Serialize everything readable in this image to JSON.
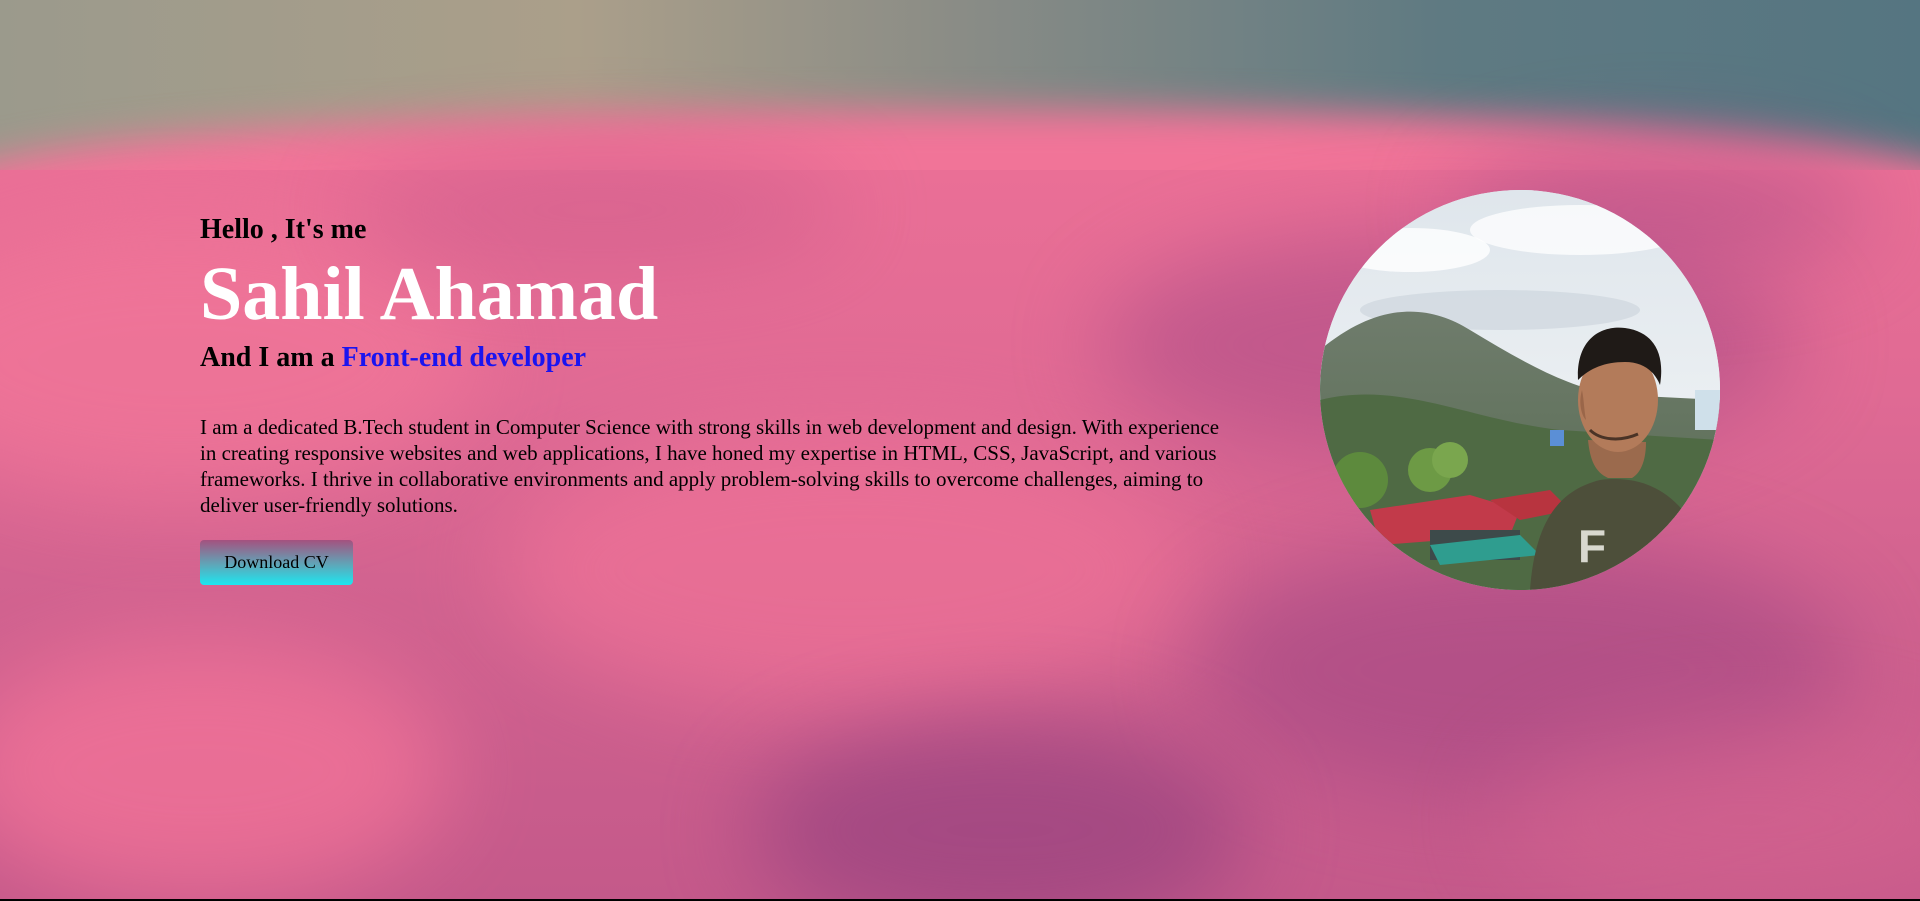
{
  "hero": {
    "greeting": "Hello , It's me",
    "name": "Sahil Ahamad",
    "role_prefix": "And I am a ",
    "role_highlight": "Front-end developer",
    "bio": "I am a dedicated B.Tech student in Computer Science with strong skills in web development and design. With experience in creating responsive websites and web applications, I have honed my expertise in HTML, CSS, JavaScript, and various frameworks. I thrive in collaborative environments and apply problem-solving skills to overcome challenges, aiming to deliver user-friendly solutions.",
    "cv_button_label": "Download CV"
  },
  "colors": {
    "name_text": "#ffffff",
    "highlight_text": "#1a14f0",
    "button_gradient_top": "#a4517f",
    "button_gradient_bottom": "#1de6f0",
    "background_pink": "#e06a94"
  },
  "profile_photo": {
    "icon": "profile-photo",
    "shape": "circle"
  }
}
